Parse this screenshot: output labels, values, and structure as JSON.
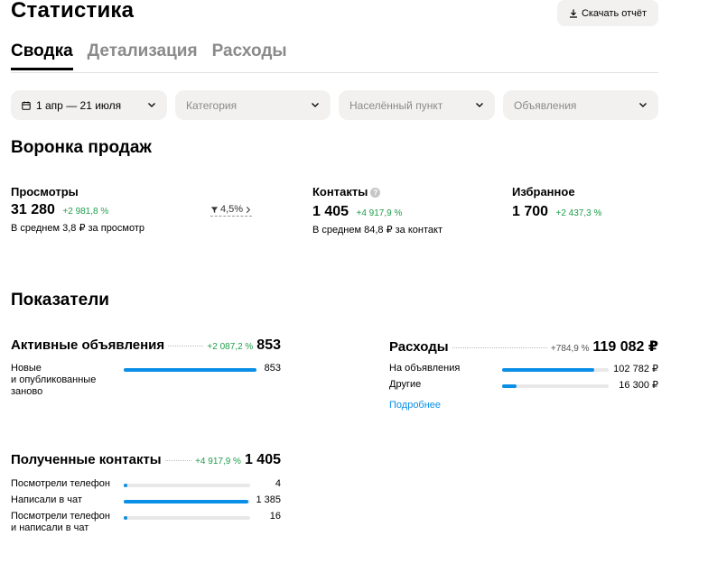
{
  "header": {
    "title": "Статистика",
    "download_label": "Скачать отчёт"
  },
  "tabs": [
    {
      "label": "Сводка",
      "active": true
    },
    {
      "label": "Детализация",
      "active": false
    },
    {
      "label": "Расходы",
      "active": false
    }
  ],
  "filters": {
    "date": "1 апр — 21 июля",
    "category": "Категория",
    "city": "Населённый пункт",
    "ads": "Объявления"
  },
  "funnel": {
    "title": "Воронка продаж",
    "views": {
      "label": "Просмотры",
      "value": "31 280",
      "delta": "+2 981,8 %",
      "sub": "В среднем 3,8 ₽ за просмотр",
      "conversion": "4,5%"
    },
    "contacts": {
      "label": "Контакты",
      "value": "1 405",
      "delta": "+4 917,9 %",
      "sub": "В среднем 84,8 ₽ за контакт"
    },
    "favorites": {
      "label": "Избранное",
      "value": "1 700",
      "delta": "+2 437,3 %"
    }
  },
  "indicators": {
    "title": "Показатели",
    "active_ads": {
      "label": "Активные объявления",
      "delta": "+2 087,2 %",
      "value": "853",
      "rows": [
        {
          "label": "Новые\nи опубликованные\nзаново",
          "value": "853",
          "fraction": 1.0
        }
      ]
    },
    "expenses": {
      "label": "Расходы",
      "delta": "+784,9 %",
      "value": "119 082 ₽",
      "rows": [
        {
          "label": "На объявления",
          "value": "102 782 ₽",
          "fraction": 0.863
        },
        {
          "label": "Другие",
          "value": "16 300 ₽",
          "fraction": 0.137
        }
      ],
      "more_link": "Подробнее"
    },
    "contacts": {
      "label": "Полученные контакты",
      "delta": "+4 917,9 %",
      "value": "1 405",
      "rows": [
        {
          "label": "Посмотрели телефон",
          "value": "4",
          "fraction": 0.003
        },
        {
          "label": "Написали в чат",
          "value": "1 385",
          "fraction": 0.986
        },
        {
          "label": "Посмотрели телефон\nи написали в чат",
          "value": "16",
          "fraction": 0.011
        }
      ]
    }
  },
  "colors": {
    "accent": "#0a8fe6",
    "positive": "#1e9e4a",
    "filter_bg": "#f2f1f0"
  }
}
